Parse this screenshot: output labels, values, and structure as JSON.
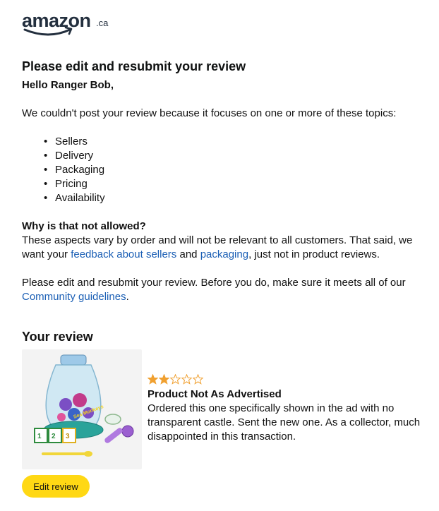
{
  "logo": {
    "word": "amazon",
    "tld": ".ca"
  },
  "email": {
    "title": "Please edit and resubmit your review",
    "greeting": "Hello Ranger Bob,",
    "intro": "We couldn't post your review because it focuses on one or more of these topics:",
    "topics": [
      "Sellers",
      "Delivery",
      "Packaging",
      "Pricing",
      "Availability"
    ],
    "why_heading": "Why is that not allowed?",
    "why_text_1": "These aspects vary by order and will not be relevant to all customers. That said, we want your ",
    "why_link_1": "feedback about sellers",
    "why_text_2": " and ",
    "why_link_2": "packaging",
    "why_text_3": ", just not in product reviews.",
    "resubmit_text": "Please edit and resubmit your review. Before you do, make sure it meets all of our ",
    "resubmit_link": "Community guidelines",
    "resubmit_end": "."
  },
  "review": {
    "section_title": "Your review",
    "rating": 2,
    "max_rating": 5,
    "headline": "Product Not As Advertised",
    "text": "Ordered this one specifically shown in the ad with no transparent castle. Sent the new one. As a collector, much disappointed in this transaction.",
    "edit_button": "Edit review"
  },
  "colors": {
    "accent_button": "#ffd814",
    "link": "#1b5fb5",
    "star": "#f0a030",
    "brand_smile": "#ff9900"
  }
}
